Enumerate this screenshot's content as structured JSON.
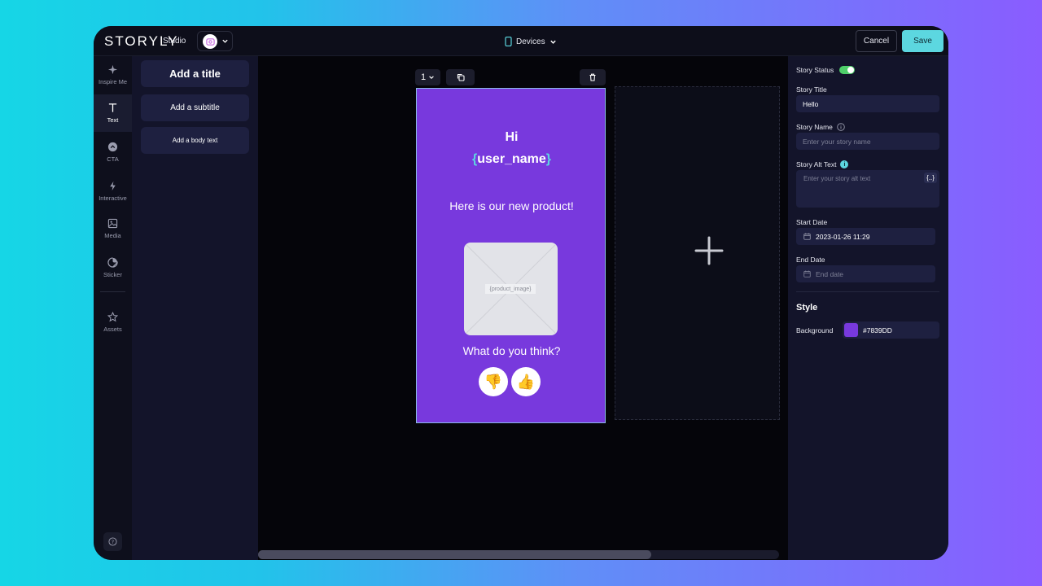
{
  "header": {
    "logo": "STORYLY",
    "studio": "Studio",
    "devices_label": "Devices",
    "cancel_label": "Cancel",
    "save_label": "Save"
  },
  "rail": {
    "items": [
      {
        "label": "Inspire Me",
        "icon": "sparkle-icon"
      },
      {
        "label": "Text",
        "icon": "text-icon"
      },
      {
        "label": "CTA",
        "icon": "cta-icon"
      },
      {
        "label": "Interactive",
        "icon": "lightning-icon"
      },
      {
        "label": "Media",
        "icon": "image-icon"
      },
      {
        "label": "Sticker",
        "icon": "sticker-icon"
      },
      {
        "label": "Assets",
        "icon": "star-icon"
      }
    ],
    "active": "Text"
  },
  "text_panel": {
    "title_btn": "Add a title",
    "subtitle_btn": "Add a subtitle",
    "body_btn": "Add a body text"
  },
  "canvas": {
    "page_number": "1",
    "story": {
      "greeting": "Hi",
      "user_var_open": "{",
      "user_var_name": "user_name",
      "user_var_close": "}",
      "text": "Here is our new product!",
      "image_label": "{product_image}",
      "question": "What do you think?",
      "emoji_down": "👎",
      "emoji_up": "👍"
    }
  },
  "settings": {
    "status_label": "Story Status",
    "status_on": true,
    "title_label": "Story Title",
    "title_value": "Hello",
    "name_label": "Story Name",
    "name_placeholder": "Enter your story name",
    "alt_label": "Story Alt Text",
    "alt_placeholder": "Enter your story alt text",
    "alt_var_button": "{..}",
    "start_label": "Start Date",
    "start_value": "2023-01-26 11:29",
    "end_label": "End Date",
    "end_placeholder": "End date",
    "style_title": "Style",
    "background_label": "Background",
    "background_value": "#7839DD"
  },
  "colors": {
    "accent": "#5cd7e0",
    "story_bg": "#7839dd",
    "toggle_on": "#4fcf6a"
  }
}
